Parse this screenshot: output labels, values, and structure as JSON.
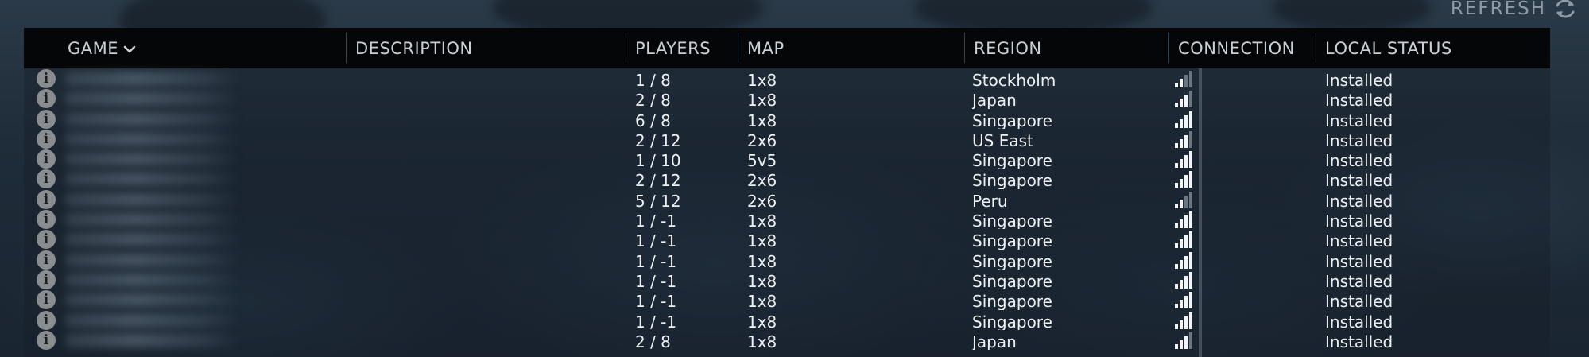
{
  "toolbar": {
    "refresh_label": "REFRESH",
    "refresh_icon": "refresh-icon"
  },
  "columns": {
    "game": "GAME",
    "description": "DESCRIPTION",
    "players": "PLAYERS",
    "map": "MAP",
    "region": "REGION",
    "connection": "CONNECTION",
    "local_status": "LOCAL STATUS"
  },
  "sort": {
    "column": "game",
    "icon": "chevron-down-icon"
  },
  "colors": {
    "header_bg": "#050607",
    "header_text": "#c9d0d6",
    "row_text": "#eef1f3",
    "signal_on": "#f2f4f5",
    "signal_off": "#6c7680",
    "info_icon": "#8a8d90"
  },
  "rows": [
    {
      "players": "1 / 8",
      "map": "1x8",
      "region": "Stockholm",
      "signal": 2,
      "status": "Installed"
    },
    {
      "players": "2 / 8",
      "map": "1x8",
      "region": "Japan",
      "signal": 3,
      "status": "Installed"
    },
    {
      "players": "6 / 8",
      "map": "1x8",
      "region": "Singapore",
      "signal": 4,
      "status": "Installed"
    },
    {
      "players": "2 / 12",
      "map": "2x6",
      "region": "US East",
      "signal": 3,
      "status": "Installed"
    },
    {
      "players": "1 / 10",
      "map": "5v5",
      "region": "Singapore",
      "signal": 4,
      "status": "Installed"
    },
    {
      "players": "2 / 12",
      "map": "2x6",
      "region": "Singapore",
      "signal": 4,
      "status": "Installed"
    },
    {
      "players": "5 / 12",
      "map": "2x6",
      "region": "Peru",
      "signal": 2,
      "status": "Installed"
    },
    {
      "players": "1 / -1",
      "map": "1x8",
      "region": "Singapore",
      "signal": 4,
      "status": "Installed"
    },
    {
      "players": "1 / -1",
      "map": "1x8",
      "region": "Singapore",
      "signal": 4,
      "status": "Installed"
    },
    {
      "players": "1 / -1",
      "map": "1x8",
      "region": "Singapore",
      "signal": 4,
      "status": "Installed"
    },
    {
      "players": "1 / -1",
      "map": "1x8",
      "region": "Singapore",
      "signal": 4,
      "status": "Installed"
    },
    {
      "players": "1 / -1",
      "map": "1x8",
      "region": "Singapore",
      "signal": 4,
      "status": "Installed"
    },
    {
      "players": "1 / -1",
      "map": "1x8",
      "region": "Singapore",
      "signal": 4,
      "status": "Installed"
    },
    {
      "players": "2 / 8",
      "map": "1x8",
      "region": "Japan",
      "signal": 3,
      "status": "Installed"
    }
  ]
}
